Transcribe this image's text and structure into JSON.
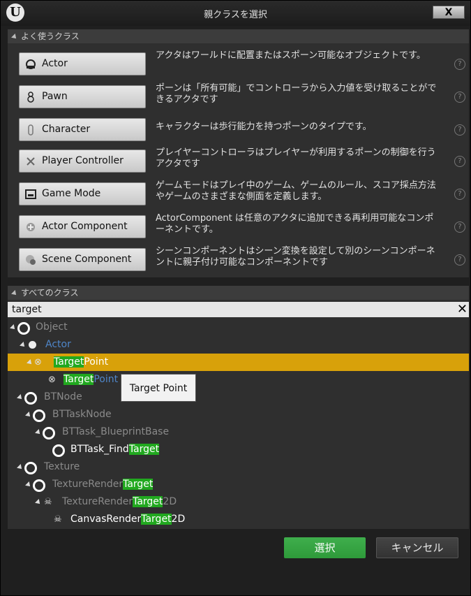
{
  "window": {
    "title": "親クラスを選択",
    "close_label": "X",
    "logo_icon": "unreal-logo-icon"
  },
  "common": {
    "header": "よく使うクラス",
    "items": [
      {
        "label": "Actor",
        "icon": "actor-icon",
        "desc": "アクタはワールドに配置またはスポーン可能なオブジェクトです。"
      },
      {
        "label": "Pawn",
        "icon": "pawn-icon",
        "desc": "ポーンは「所有可能」でコントローラから入力値を受け取ることができるアクタです"
      },
      {
        "label": "Character",
        "icon": "character-icon",
        "desc": "キャラクターは歩行能力を持つポーンのタイプです。"
      },
      {
        "label": "Player Controller",
        "icon": "player-controller-icon",
        "desc": "プレイヤーコントローラはプレイヤーが利用するポーンの制御を行うアクタです"
      },
      {
        "label": "Game Mode",
        "icon": "game-mode-icon",
        "desc": "ゲームモードはプレイ中のゲーム、ゲームのルール、スコア採点方法やゲームのさまざまな側面を定義します。"
      },
      {
        "label": "Actor Component",
        "icon": "actor-component-icon",
        "desc": "ActorComponent は任意のアクタに追加できる再利用可能なコンポーネントです。"
      },
      {
        "label": "Scene Component",
        "icon": "scene-component-icon",
        "desc": "シーンコンポーネントはシーン変換を設定して別のシーンコンポーネントに親子付け可能なコンポーネントです"
      }
    ],
    "help_glyph": "?"
  },
  "all": {
    "header": "すべてのクラス",
    "search_value": "target",
    "clear_glyph": "✕",
    "tree": {
      "object": "Object",
      "actor": "Actor",
      "targetpoint_parent": {
        "hl": "Target",
        "rest": "Point"
      },
      "targetpoint_child": {
        "hl": "Target",
        "rest": "Point"
      },
      "btnode": "BTNode",
      "bttasknode": "BTTaskNode",
      "bttask_blueprintbase": "BTTask_BlueprintBase",
      "bttask_findtarget": {
        "pre": "BTTask_Find",
        "hl": "Target"
      },
      "texture": "Texture",
      "texturerendertarget": {
        "pre": "TextureRender",
        "hl": "Target"
      },
      "texturerendertarget2d": {
        "pre": "TextureRender",
        "hl": "Target",
        "post": "2D"
      },
      "canvasrendertarget2d": {
        "pre": "CanvasRender",
        "hl": "Target",
        "post": "2D"
      }
    },
    "tooltip": "Target Point"
  },
  "footer": {
    "select_label": "選択",
    "cancel_label": "キャンセル"
  }
}
